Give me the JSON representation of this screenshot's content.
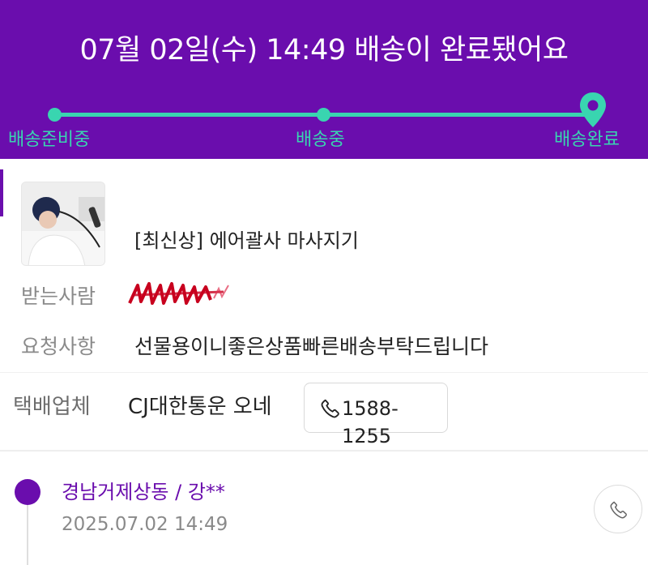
{
  "header": {
    "title": "07월 02일(수) 14:49 배송이 완료됐어요",
    "steps": [
      {
        "label": "배송준비중"
      },
      {
        "label": "배송중"
      },
      {
        "label": "배송완료"
      }
    ],
    "current_step": 3,
    "background_color": "#6a0dad",
    "track_color": "#39d5b0"
  },
  "order": {
    "product_name": "[최신상] 에어괄사 마사지기",
    "recipient_label": "받는사람",
    "request_label": "요청사항",
    "request_value": "선물용이니좋은상품빠른배송부탁드립니다"
  },
  "courier": {
    "label": "택배업체",
    "name": "CJ대한통운 오네",
    "phone": "1588-1255"
  },
  "tracking": {
    "entries": [
      {
        "location": "경남거제상동 / 강**",
        "time": "2025.07.02 14:49"
      }
    ]
  }
}
